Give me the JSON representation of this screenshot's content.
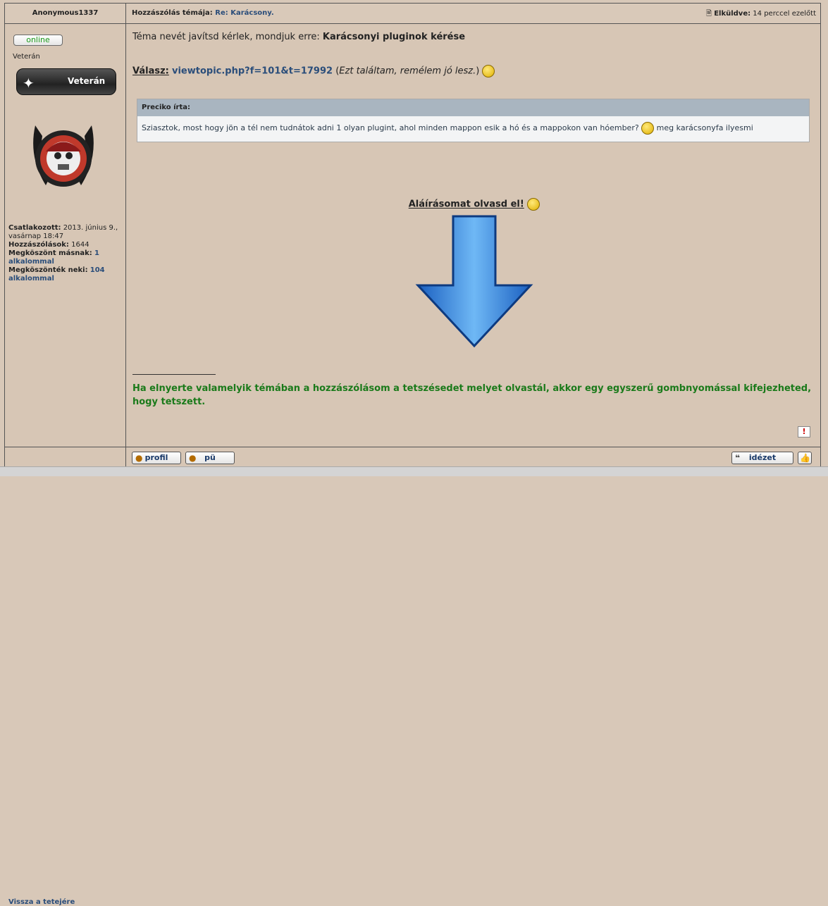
{
  "post": {
    "author": "Anonymous1337",
    "subject_label": "Hozzászólás témája:",
    "subject_link": "Re: Karácsony.",
    "sent_label": "Elküldve:",
    "sent_value": "14 perccel ezelőtt"
  },
  "profile": {
    "online_label": "online",
    "rank_text": "Veterán",
    "rank_badge_label": "Veterán",
    "joined_label": "Csatlakozott:",
    "joined_value": "2013. június 9., vasárnap 18:47",
    "posts_label": "Hozzászólások:",
    "posts_value": "1644",
    "thanked_label": "Megköszönt másnak:",
    "thanked_value": "1 alkalommal",
    "thanks_received_label": "Megköszönték neki:",
    "thanks_received_value": "104 alkalommal",
    "back_to_top": "Vissza a tetejére"
  },
  "body": {
    "line1_text": "Téma nevét javítsd kérlek, mondjuk erre: ",
    "line1_bold": "Karácsonyi pluginok kérése",
    "answer_label": "Válasz:",
    "answer_link": "viewtopic.php?f=101&t=17992",
    "answer_note_open": " (",
    "answer_note": "Ezt találtam, remélem jó lesz.",
    "answer_note_close": ")",
    "quote_header": "Preciko írta:",
    "quote_text_1": "Sziasztok, most hogy jön a tél nem tudnátok adni 1 olyan plugint, ahol minden mappon esik a hó és a mappokon van hóember?",
    "quote_text_2": " meg karácsonyfa ilyesmi",
    "signature_title": "Aláírásomat olvasd el!",
    "signature_rule": "_______________",
    "signature_text": "Ha elnyerte valamelyik témában a hozzászólásom a tetszésedet melyet olvastál, akkor egy egyszerű gombnyomással kifejezheted, hogy tetszett."
  },
  "buttons": {
    "profile": "profil",
    "pm": "pü",
    "quote": "idézet",
    "report": "!"
  },
  "icons": {
    "smiley": "smiley-icon",
    "arrow": "down-arrow-icon",
    "report": "report-icon"
  }
}
